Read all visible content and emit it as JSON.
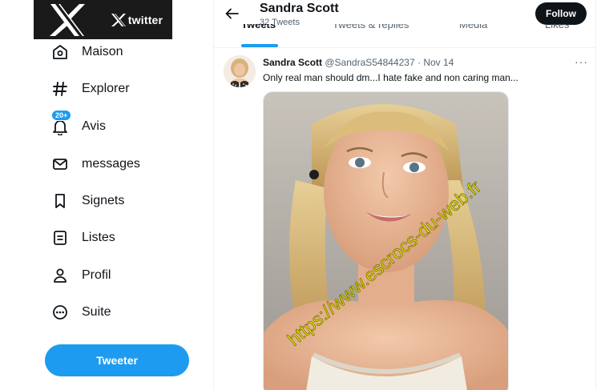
{
  "logo": {
    "big_icon": "x-logo-icon",
    "small_icon": "x-logo-icon",
    "small_word": "twitter"
  },
  "sidebar": {
    "items": [
      {
        "label": "Maison",
        "icon": "home-icon"
      },
      {
        "label": "Explorer",
        "icon": "hashtag-icon"
      },
      {
        "label": "Avis",
        "icon": "bell-icon",
        "badge": "20+"
      },
      {
        "label": "messages",
        "icon": "envelope-icon"
      },
      {
        "label": "Signets",
        "icon": "bookmark-icon"
      },
      {
        "label": "Listes",
        "icon": "list-icon"
      },
      {
        "label": "Profil",
        "icon": "person-icon"
      },
      {
        "label": "Suite",
        "icon": "more-circle-icon"
      }
    ],
    "tweet_button": "Tweeter"
  },
  "header": {
    "name": "Sandra Scott",
    "tweet_count": "32 Tweets",
    "follow": "Follow"
  },
  "tabs": [
    {
      "label": "Tweets",
      "active": true
    },
    {
      "label": "Tweets & replies",
      "active": false
    },
    {
      "label": "Media",
      "active": false
    },
    {
      "label": "Likes",
      "active": false
    }
  ],
  "tweet": {
    "author": "Sandra Scott",
    "handle": "@SandraS54844237",
    "separator": "·",
    "date": "Nov 14",
    "text": "Only real man should dm...I hate fake and non caring man...",
    "more": "···",
    "watermark": "https://www.escrocs-du-web.fr"
  },
  "colors": {
    "accent": "#1d9bf0",
    "text": "#0f1419",
    "muted": "#536471",
    "follow_bg": "#0f1419",
    "watermark": "#e8e000"
  }
}
